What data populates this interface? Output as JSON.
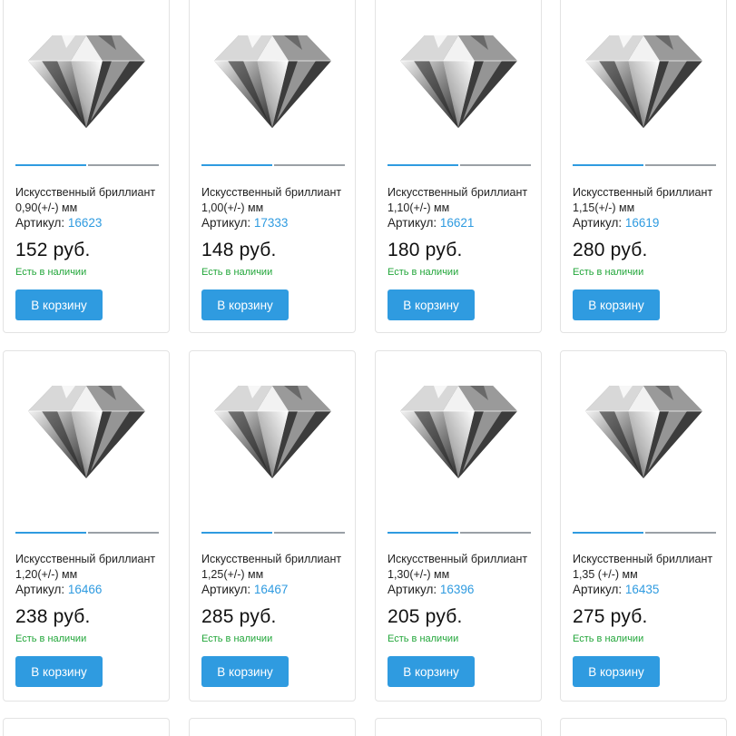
{
  "colors": {
    "accent": "#2f9be0",
    "in_stock": "#22a63a"
  },
  "products": [
    {
      "title": "Искусственный бриллиант 0,90(+/-) мм",
      "sku_label": "Артикул:",
      "sku": "16623",
      "price": "152 руб.",
      "stock": "Есть в наличии",
      "button": "В корзину"
    },
    {
      "title": "Искусственный бриллиант 1,00(+/-) мм",
      "sku_label": "Артикул:",
      "sku": "17333",
      "price": "148 руб.",
      "stock": "Есть в наличии",
      "button": "В корзину"
    },
    {
      "title": "Искусственный бриллиант 1,10(+/-) мм",
      "sku_label": "Артикул:",
      "sku": "16621",
      "price": "180 руб.",
      "stock": "Есть в наличии",
      "button": "В корзину"
    },
    {
      "title": "Искусственный бриллиант 1,15(+/-) мм",
      "sku_label": "Артикул:",
      "sku": "16619",
      "price": "280 руб.",
      "stock": "Есть в наличии",
      "button": "В корзину"
    },
    {
      "title": "Искусственный бриллиант 1,20(+/-) мм",
      "sku_label": "Артикул:",
      "sku": "16466",
      "price": "238 руб.",
      "stock": "Есть в наличии",
      "button": "В корзину"
    },
    {
      "title": "Искусственный бриллиант 1,25(+/-) мм",
      "sku_label": "Артикул:",
      "sku": "16467",
      "price": "285 руб.",
      "stock": "Есть в наличии",
      "button": "В корзину"
    },
    {
      "title": "Искусственный бриллиант 1,30(+/-) мм",
      "sku_label": "Артикул:",
      "sku": "16396",
      "price": "205 руб.",
      "stock": "Есть в наличии",
      "button": "В корзину"
    },
    {
      "title": "Искусственный бриллиант 1,35 (+/-) мм",
      "sku_label": "Артикул:",
      "sku": "16435",
      "price": "275 руб.",
      "stock": "Есть в наличии",
      "button": "В корзину"
    }
  ],
  "image_icon": "diamond-icon"
}
